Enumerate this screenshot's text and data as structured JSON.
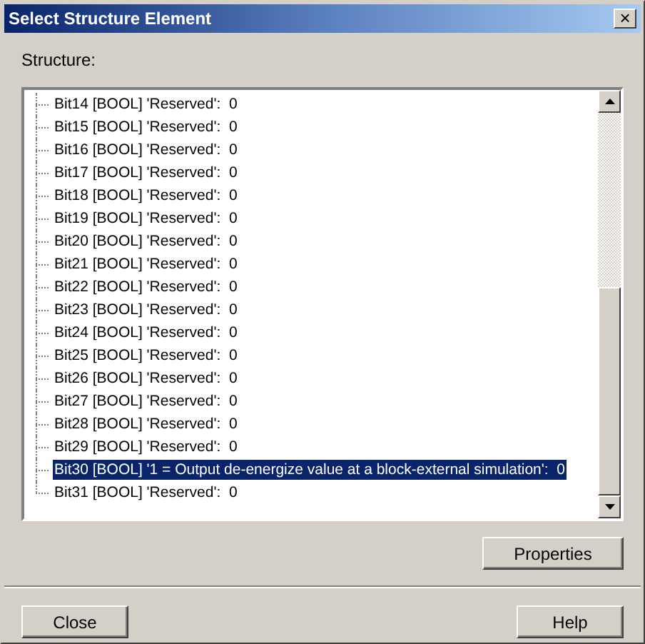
{
  "window": {
    "title": "Select Structure Element",
    "close_glyph": "×"
  },
  "structure_label": "Structure:",
  "tree": {
    "items": [
      {
        "label": "Bit14 [BOOL] 'Reserved':  0",
        "selected": false
      },
      {
        "label": "Bit15 [BOOL] 'Reserved':  0",
        "selected": false
      },
      {
        "label": "Bit16 [BOOL] 'Reserved':  0",
        "selected": false
      },
      {
        "label": "Bit17 [BOOL] 'Reserved':  0",
        "selected": false
      },
      {
        "label": "Bit18 [BOOL] 'Reserved':  0",
        "selected": false
      },
      {
        "label": "Bit19 [BOOL] 'Reserved':  0",
        "selected": false
      },
      {
        "label": "Bit20 [BOOL] 'Reserved':  0",
        "selected": false
      },
      {
        "label": "Bit21 [BOOL] 'Reserved':  0",
        "selected": false
      },
      {
        "label": "Bit22 [BOOL] 'Reserved':  0",
        "selected": false
      },
      {
        "label": "Bit23 [BOOL] 'Reserved':  0",
        "selected": false
      },
      {
        "label": "Bit24 [BOOL] 'Reserved':  0",
        "selected": false
      },
      {
        "label": "Bit25 [BOOL] 'Reserved':  0",
        "selected": false
      },
      {
        "label": "Bit26 [BOOL] 'Reserved':  0",
        "selected": false
      },
      {
        "label": "Bit27 [BOOL] 'Reserved':  0",
        "selected": false
      },
      {
        "label": "Bit28 [BOOL] 'Reserved':  0",
        "selected": false
      },
      {
        "label": "Bit29 [BOOL] 'Reserved':  0",
        "selected": false
      },
      {
        "label": "Bit30 [BOOL] '1 = Output de-energize value at a block-external simulation':  0",
        "selected": true
      },
      {
        "label": "Bit31 [BOOL] 'Reserved':  0",
        "selected": false
      }
    ]
  },
  "buttons": {
    "properties": "Properties",
    "close": "Close",
    "help": "Help"
  }
}
